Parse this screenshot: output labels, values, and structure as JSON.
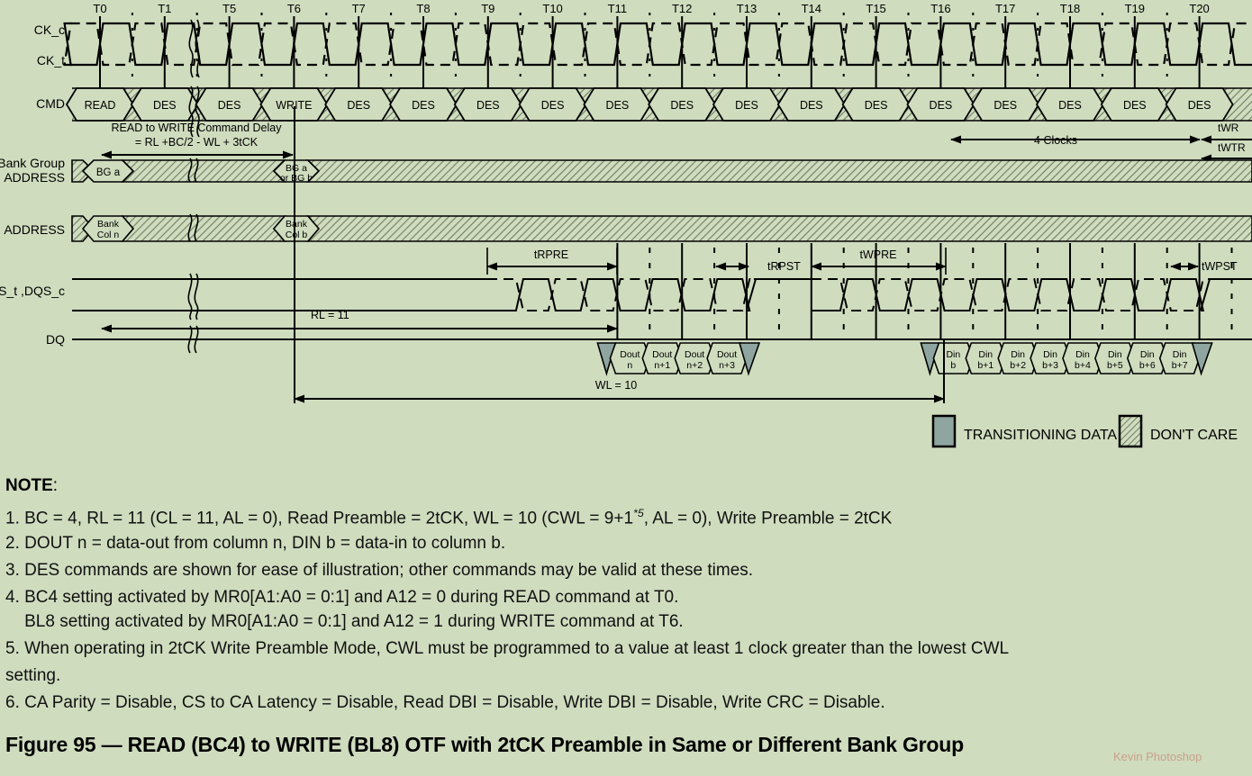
{
  "figure": {
    "background_color": "#cfdcbe",
    "title": "Figure 95 — READ (BC4) to WRITE (BL8) OTF with 2tCK Preamble in Same or Different Bank Group",
    "watermark": "Kevin Photoshop"
  },
  "row_labels": {
    "ck_c": "CK_c",
    "ck_t": "CK_t",
    "cmd": "CMD",
    "bank_group_line1": "Bank Group",
    "bank_group_line2": "ADDRESS",
    "address": "ADDRESS",
    "dqs": "DQS_t ,DQS_c",
    "dq": "DQ"
  },
  "time_ticks": [
    "T0",
    "T1",
    "T5",
    "T6",
    "T7",
    "T8",
    "T9",
    "T10",
    "T11",
    "T12",
    "T13",
    "T14",
    "T15",
    "T16",
    "T17",
    "T18",
    "T19",
    "T20"
  ],
  "commands": [
    "READ",
    "DES",
    "DES",
    "WRITE",
    "DES",
    "DES",
    "DES",
    "DES",
    "DES",
    "DES",
    "DES",
    "DES",
    "DES",
    "DES",
    "DES",
    "DES",
    "DES",
    "DES"
  ],
  "bank_group": {
    "first_line1": "BG a",
    "first_line2": "",
    "second_line1": "BG a",
    "second_line2": "or BG b"
  },
  "address_row": {
    "first_line1": "Bank",
    "first_line2": "Col n",
    "second_line1": "Bank",
    "second_line2": "Col b"
  },
  "annotations": {
    "read_to_write_line1": "READ to WRITE Command Delay",
    "read_to_write_line2": "= RL +BC/2 - WL + 3tCK",
    "four_clocks": "4 Clocks",
    "twr": "tWR",
    "twtr": "tWTR",
    "trpre": "tRPRE",
    "trpst": "tRPST",
    "twpre": "tWPRE",
    "twpst": "tWPST",
    "rl": "RL = 11",
    "wl": "WL = 10"
  },
  "dq_out": [
    "Dout\nn",
    "Dout\nn+1",
    "Dout\nn+2",
    "Dout\nn+3"
  ],
  "dq_out_cells": [
    {
      "l1": "Dout",
      "l2": "n"
    },
    {
      "l1": "Dout",
      "l2": "n+1"
    },
    {
      "l1": "Dout",
      "l2": "n+2"
    },
    {
      "l1": "Dout",
      "l2": "n+3"
    }
  ],
  "dq_in_cells": [
    {
      "l1": "Din",
      "l2": "b"
    },
    {
      "l1": "Din",
      "l2": "b+1"
    },
    {
      "l1": "Din",
      "l2": "b+2"
    },
    {
      "l1": "Din",
      "l2": "b+3"
    },
    {
      "l1": "Din",
      "l2": "b+4"
    },
    {
      "l1": "Din",
      "l2": "b+5"
    },
    {
      "l1": "Din",
      "l2": "b+6"
    },
    {
      "l1": "Din",
      "l2": "b+7"
    }
  ],
  "legend": {
    "transitioning": "TRANSITIONING DATA",
    "dont_care": "DON'T CARE",
    "transitioning_color": "#8ea5a0",
    "dont_care_color": "#c6d4b4"
  },
  "notes": {
    "heading": "NOTE",
    "heading_colon": ":",
    "items": [
      "1. BC = 4, RL = 11 (CL = 11, AL = 0), Read Preamble = 2tCK, WL = 10 (CWL = 9+1*5, AL = 0), Write Preamble = 2tCK",
      "2. DOUT n = data-out from column n, DIN b = data-in to column b.",
      "3. DES commands are shown for ease of illustration; other commands may be valid at these times.",
      "4. BC4 setting activated by MR0[A1:A0 = 0:1] and A12 = 0 during READ command at T0.",
      "    BL8 setting activated by MR0[A1:A0 = 0:1] and A12 = 1 during WRITE command at T6.",
      "5. When operating in 2tCK Write Preamble Mode, CWL must be programmed to a value at least 1 clock greater than the lowest CWL",
      "setting.",
      "6. CA Parity = Disable, CS to CA Latency = Disable, Read DBI = Disable, Write DBI = Disable, Write CRC = Disable."
    ],
    "note1_pre": "1. BC = 4, RL = 11 (CL = 11, AL = 0), Read Preamble = 2tCK, WL = 10 (CWL = 9+1",
    "note1_sup": "*5",
    "note1_post": ", AL = 0), Write Preamble = 2tCK"
  }
}
